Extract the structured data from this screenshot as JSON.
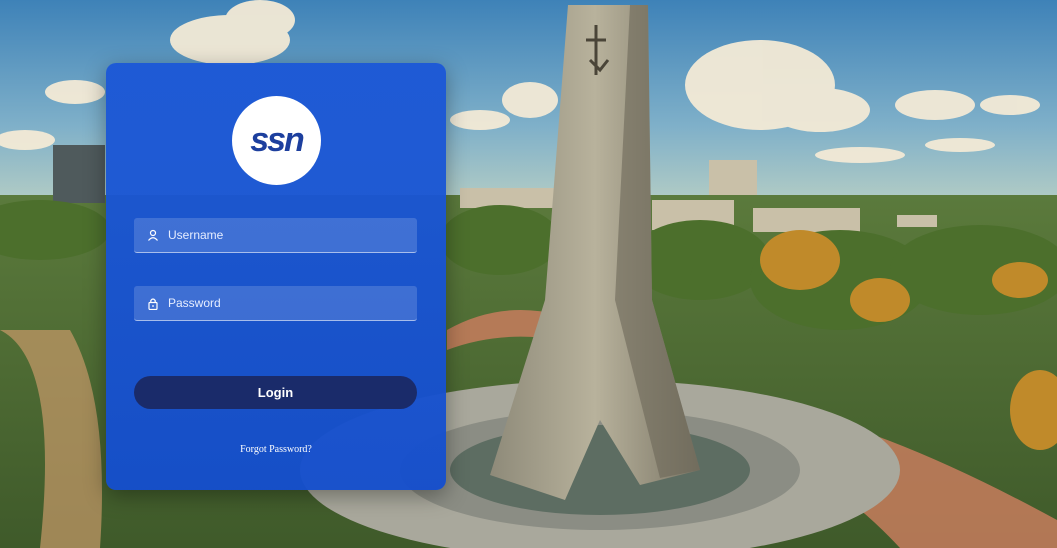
{
  "logo": {
    "text": "ssn",
    "icon": "ssn-logo"
  },
  "login_form": {
    "username": {
      "placeholder": "Username",
      "value": "",
      "icon": "user-icon"
    },
    "password": {
      "placeholder": "Password",
      "value": "",
      "icon": "lock-icon"
    },
    "login_label": "Login",
    "forgot_label": "Forgot Password?"
  },
  "colors": {
    "card": "#1c58d6",
    "button": "#1a2b6a",
    "logo_text": "#1d3f9e"
  }
}
